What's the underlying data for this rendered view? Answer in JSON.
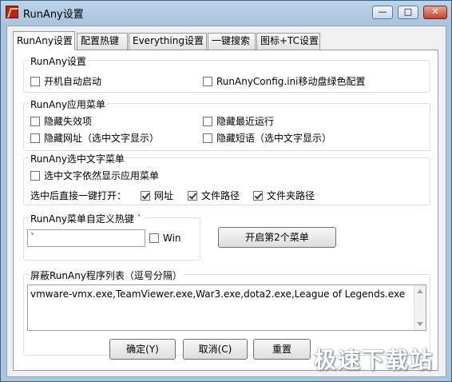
{
  "window": {
    "title": "RunAny设置",
    "min_glyph": "—",
    "max_glyph": "□",
    "close_glyph": "✕"
  },
  "tabs": [
    {
      "label": "RunAny设置",
      "active": true
    },
    {
      "label": "配置热键",
      "active": false
    },
    {
      "label": "Everything设置",
      "active": false
    },
    {
      "label": "一键搜索",
      "active": false
    },
    {
      "label": "图标+TC设置",
      "active": false
    }
  ],
  "groups": {
    "settings": {
      "title": "RunAny设置",
      "autostart": {
        "label": "开机自动启动",
        "checked": false
      },
      "portable": {
        "label": "RunAnyConfig.ini移动盘绿色配置",
        "checked": false
      }
    },
    "menu": {
      "title": "RunAny应用菜单",
      "hide_invalid": {
        "label": "隐藏失效项",
        "checked": false
      },
      "hide_recent": {
        "label": "隐藏最近运行",
        "checked": false
      },
      "hide_url": {
        "label": "隐藏网址（选中文字显示）",
        "checked": false
      },
      "hide_phrase": {
        "label": "隐藏短语（选中文字显示）",
        "checked": false
      }
    },
    "selection": {
      "title": "RunAny选中文字菜单",
      "still_show": {
        "label": "选中文字依然显示应用菜单",
        "checked": false
      },
      "direct_open_label": "选中后直接一键打开：",
      "url": {
        "label": "网址",
        "checked": true
      },
      "file_path": {
        "label": "文件路径",
        "checked": true
      },
      "folder_path": {
        "label": "文件夹路径",
        "checked": true
      }
    },
    "hotkey": {
      "title": "RunAny菜单自定义热键 `",
      "value": "`",
      "win": {
        "label": "Win",
        "checked": false
      },
      "second_menu_button": "开启第2个菜单"
    },
    "blocklist": {
      "title": "屏蔽RunAny程序列表（逗号分隔）",
      "value": "vmware-vmx.exe,TeamViewer.exe,War3.exe,dota2.exe,League of Legends.exe"
    }
  },
  "buttons": {
    "ok": "确定(Y)",
    "cancel": "取消(C)",
    "reset": "重置"
  },
  "watermark": "极速下载站"
}
